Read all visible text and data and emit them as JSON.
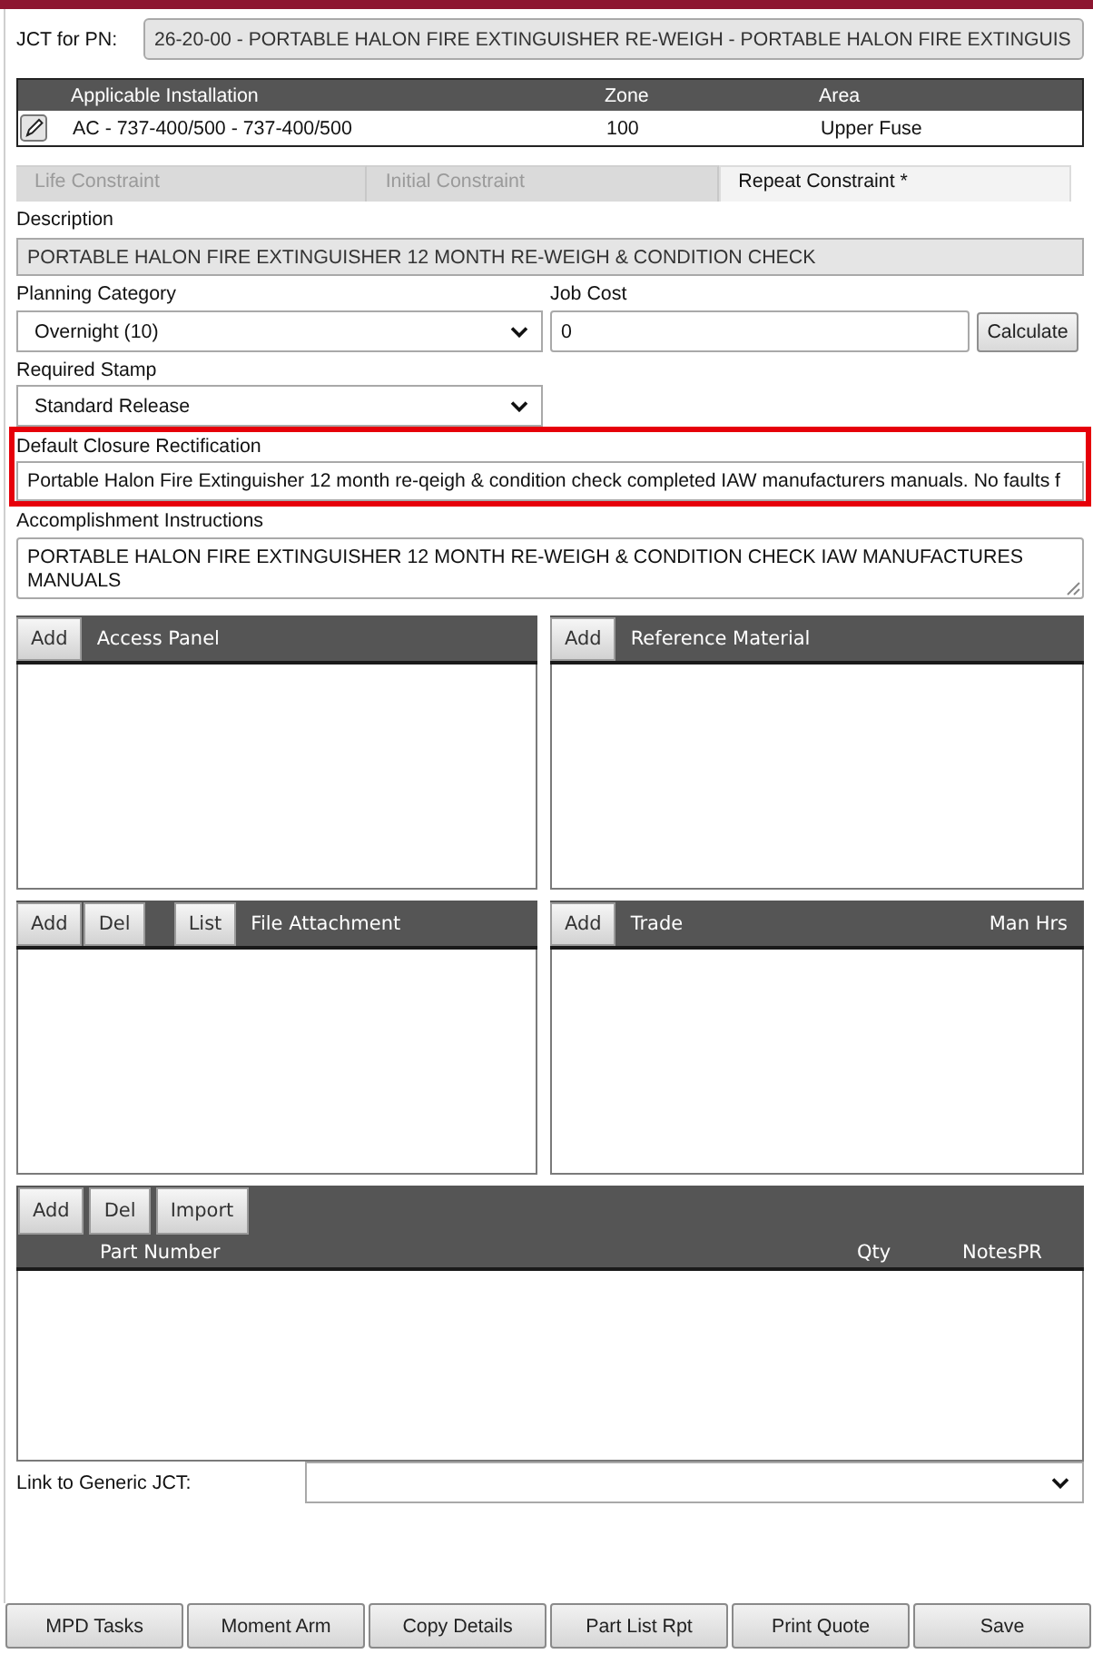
{
  "jct_for_pn": {
    "label": "JCT for PN:",
    "value": "26-20-00 - PORTABLE HALON FIRE EXTINGUISHER RE-WEIGH - PORTABLE HALON FIRE EXTINGUIS",
    "read_only": true
  },
  "installations": {
    "columns": [
      "Applicable Installation",
      "Zone",
      "Area"
    ],
    "rows": [
      {
        "cells": [
          "AC - 737-400/500 - 737-400/500",
          "100",
          "Upper Fuse"
        ]
      }
    ]
  },
  "tabs": [
    {
      "label": "Life Constraint",
      "selected": false
    },
    {
      "label": "Initial Constraint",
      "selected": false
    },
    {
      "label": "Repeat Constraint *",
      "selected": true
    }
  ],
  "description": {
    "label": "Description",
    "value": "PORTABLE HALON FIRE EXTINGUISHER 12 MONTH RE-WEIGH & CONDITION CHECK",
    "read_only": true
  },
  "planning_category": {
    "label": "Planning Category",
    "value": "Overnight (10)"
  },
  "job_cost": {
    "label": "Job Cost",
    "value": "0",
    "button": "Calculate"
  },
  "required_stamp": {
    "label": "Required Stamp",
    "value": "Standard Release"
  },
  "default_closure_rectification": {
    "label": "Default Closure Rectification",
    "value": "Portable Halon Fire Extinguisher 12 month re-qeigh & condition check completed IAW manufacturers manuals. No faults f",
    "highlighted": true
  },
  "accomplishment_instructions": {
    "label": "Accomplishment Instructions",
    "value": "PORTABLE HALON FIRE EXTINGUISHER 12 MONTH RE-WEIGH & CONDITION CHECK IAW MANUFACTURES MANUALS"
  },
  "panels": [
    {
      "button_groups": [
        [
          "Add"
        ]
      ],
      "title": "Access Panel"
    },
    {
      "button_groups": [
        [
          "Add"
        ]
      ],
      "title": "Reference Material"
    },
    {
      "button_groups": [
        [
          "Add",
          "Del"
        ],
        [
          "List"
        ]
      ],
      "title": "File Attachment"
    },
    {
      "button_groups": [
        [
          "Add"
        ]
      ],
      "title": "Trade",
      "right_column": "Man Hrs"
    }
  ],
  "parts": {
    "buttons": [
      "Add",
      "Del",
      "Import"
    ],
    "columns": [
      "Part Number",
      "Qty",
      "NotesPR"
    ]
  },
  "link_to_generic_jct": {
    "label": "Link to Generic JCT:"
  },
  "footer_buttons": [
    "MPD Tasks",
    "Moment Arm",
    "Copy Details",
    "Part List Rpt",
    "Print Quote",
    "Save"
  ]
}
